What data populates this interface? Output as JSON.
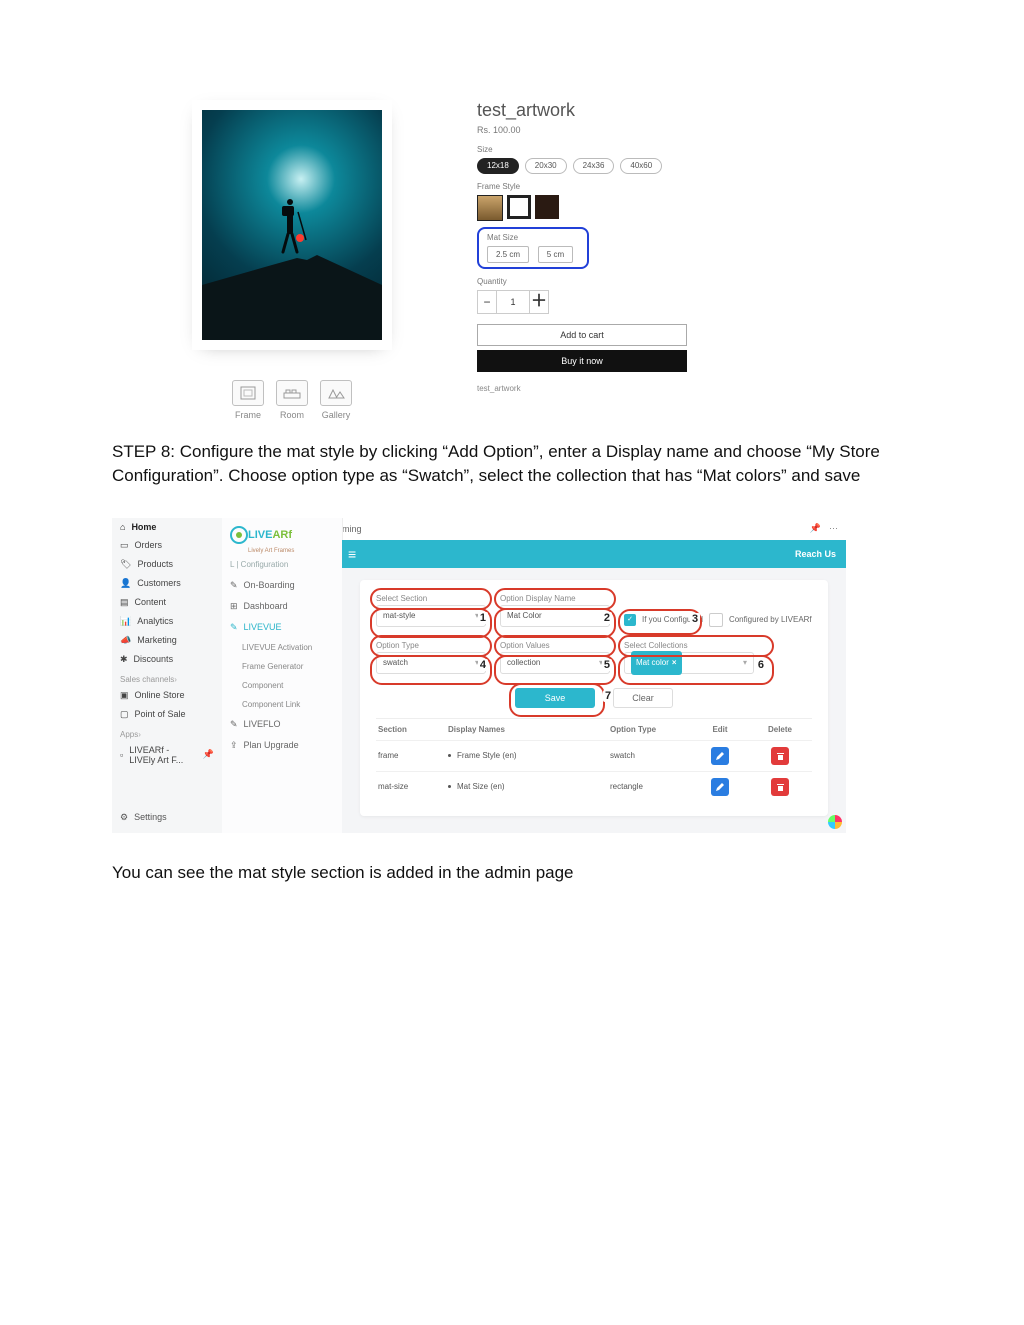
{
  "product": {
    "title": "test_artwork",
    "price": "Rs. 100.00",
    "size_label": "Size",
    "sizes": [
      "12x18",
      "20x30",
      "24x36",
      "40x60"
    ],
    "selected_size_index": 0,
    "framestyle_label": "Frame Style",
    "matsize_label": "Mat Size",
    "matsizes": [
      "2.5 cm",
      "5 cm"
    ],
    "qty_label": "Quantity",
    "qty_value": "1",
    "add_to_cart": "Add to cart",
    "buy_now": "Buy it now",
    "breadcrumb": "test_artwork",
    "thumbs": [
      "Frame",
      "Room",
      "Gallery"
    ]
  },
  "step_text": "STEP 8: Configure the mat style by clicking “Add Option”, enter a Display name and choose “My Store Configuration”. Choose option type as “Swatch”, select the collection that has “Mat colors” and save",
  "after_text": "You can see the mat style section is added in the admin page",
  "admin": {
    "app_title": "LIVEARf - LIVEly Art Framing",
    "reach_us": "Reach Us",
    "shopify_nav": [
      {
        "icon": "home",
        "label": "Home",
        "bold": true
      },
      {
        "icon": "orders",
        "label": "Orders"
      },
      {
        "icon": "tag",
        "label": "Products"
      },
      {
        "icon": "person",
        "label": "Customers"
      },
      {
        "icon": "content",
        "label": "Content"
      },
      {
        "icon": "analytics",
        "label": "Analytics"
      },
      {
        "icon": "marketing",
        "label": "Marketing"
      },
      {
        "icon": "discounts",
        "label": "Discounts"
      }
    ],
    "sales_channels_label": "Sales channels",
    "sales_channels": [
      {
        "icon": "store",
        "label": "Online Store"
      },
      {
        "icon": "pos",
        "label": "Point of Sale"
      }
    ],
    "apps_label": "Apps",
    "apps": [
      {
        "icon": "app",
        "label": "LIVEARf - LIVEly Art F..."
      }
    ],
    "settings_label": "Settings",
    "brand": "LIVEARf",
    "brand_tag": "Lively Art Frames",
    "config_label": "L | Configuration",
    "app_nav": [
      {
        "label": "On-Boarding",
        "icon": "rocket"
      },
      {
        "label": "Dashboard",
        "icon": "dash"
      },
      {
        "label": "LIVEVUE",
        "icon": "rocket",
        "active": true
      },
      {
        "label": "LIVEVUE Activation",
        "sub": true
      },
      {
        "label": "Frame Generator",
        "sub": true
      },
      {
        "label": "Component",
        "sub": true,
        "active": true
      },
      {
        "label": "Component Link",
        "sub": true
      },
      {
        "label": "LIVEFLO",
        "icon": "rocket"
      },
      {
        "label": "Plan Upgrade",
        "icon": "plan"
      }
    ],
    "fields": {
      "select_section_label": "Select Section",
      "select_section_value": "mat-style",
      "display_name_label": "Option Display Name",
      "display_name_value": "Mat Color",
      "configured_prefix": "If you Configured",
      "configured_suffix": "Configured by LIVEARf",
      "option_type_label": "Option Type",
      "option_type_value": "swatch",
      "option_values_label": "Option Values",
      "option_values_value": "collection",
      "select_collections_label": "Select Collections",
      "collection_chip": "Mat color",
      "save": "Save",
      "clear": "Clear"
    },
    "numbers": {
      "section": "1",
      "display": "2",
      "configured": "3",
      "otype": "4",
      "ovalues": "5",
      "coll": "6",
      "save": "7"
    },
    "table": {
      "headers": {
        "section": "Section",
        "display": "Display Names",
        "otype": "Option Type",
        "edit": "Edit",
        "delete": "Delete"
      },
      "rows": [
        {
          "section": "frame",
          "display": "Frame Style (en)",
          "otype": "swatch"
        },
        {
          "section": "mat-size",
          "display": "Mat Size (en)",
          "otype": "rectangle"
        }
      ]
    }
  }
}
